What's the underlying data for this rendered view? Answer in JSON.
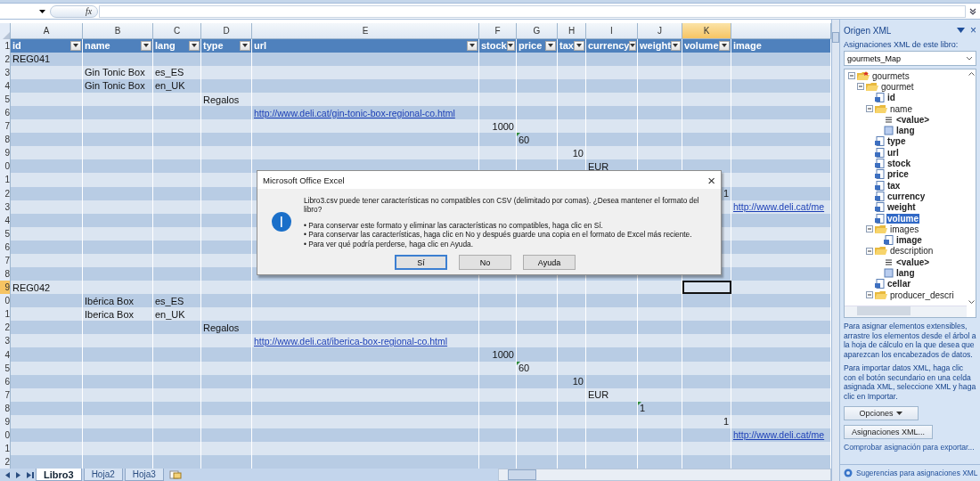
{
  "formula_bar": {
    "function_label": "fx"
  },
  "columns": [
    {
      "letter": "A",
      "header": "id",
      "filter": true,
      "selected": false
    },
    {
      "letter": "B",
      "header": "name",
      "filter": true,
      "selected": false
    },
    {
      "letter": "C",
      "header": "lang",
      "filter": true,
      "selected": false
    },
    {
      "letter": "D",
      "header": "type",
      "filter": true,
      "selected": false
    },
    {
      "letter": "E",
      "header": "url",
      "filter": true,
      "selected": false
    },
    {
      "letter": "F",
      "header": "stock",
      "filter": true,
      "selected": false
    },
    {
      "letter": "G",
      "header": "price",
      "filter": true,
      "selected": false
    },
    {
      "letter": "H",
      "header": "tax",
      "filter": true,
      "selected": false
    },
    {
      "letter": "I",
      "header": "currency",
      "filter": true,
      "selected": false
    },
    {
      "letter": "J",
      "header": "weight",
      "filter": true,
      "selected": false
    },
    {
      "letter": "K",
      "header": "volume",
      "filter": true,
      "selected": true
    },
    {
      "header": "image",
      "filter": false,
      "selected": false
    }
  ],
  "header_row_number": "1",
  "rows": [
    {
      "number": "2",
      "selected": false,
      "cells": [
        {
          "text": "REG041",
          "kind": "text",
          "active": false
        }
      ]
    },
    {
      "number": "3",
      "selected": false,
      "cells": [
        null,
        {
          "text": "Gin Tonic Box",
          "kind": "text",
          "active": false
        },
        {
          "text": "es_ES",
          "kind": "text",
          "active": false
        }
      ]
    },
    {
      "number": "4",
      "selected": false,
      "cells": [
        null,
        {
          "text": "Gin Tonic Box",
          "kind": "text",
          "active": false
        },
        {
          "text": "en_UK",
          "kind": "text",
          "active": false
        }
      ]
    },
    {
      "number": "5",
      "selected": false,
      "cells": [
        null,
        null,
        null,
        {
          "text": "Regalos",
          "kind": "text",
          "active": false
        }
      ]
    },
    {
      "number": "6",
      "selected": false,
      "cells": [
        null,
        null,
        null,
        null,
        {
          "text": "http://www.deli.cat/gin-tonic-box-regional-co.html",
          "kind": "link",
          "active": false
        }
      ]
    },
    {
      "number": "7",
      "selected": false,
      "cells": [
        null,
        null,
        null,
        null,
        null,
        {
          "text": "1000",
          "kind": "number",
          "active": false
        }
      ]
    },
    {
      "number": "8",
      "selected": false,
      "cells": [
        null,
        null,
        null,
        null,
        null,
        null,
        {
          "text": "60",
          "kind": "number_as_text",
          "active": false
        }
      ]
    },
    {
      "number": "9",
      "selected": false,
      "cells": [
        null,
        null,
        null,
        null,
        null,
        null,
        null,
        {
          "text": "10",
          "kind": "number",
          "active": false
        }
      ]
    },
    {
      "number": "0",
      "selected": false,
      "cells": [
        null,
        null,
        null,
        null,
        null,
        null,
        null,
        null,
        {
          "text": "EUR",
          "kind": "text",
          "active": false
        }
      ]
    },
    {
      "number": "1",
      "selected": false
    },
    {
      "number": "2",
      "selected": false,
      "cells": [
        null,
        null,
        null,
        null,
        null,
        null,
        null,
        null,
        null,
        null,
        {
          "text": "1",
          "kind": "number",
          "active": false
        }
      ]
    },
    {
      "number": "3",
      "selected": false,
      "cells": [
        null,
        null,
        null,
        null,
        null,
        null,
        null,
        null,
        null,
        null,
        null,
        {
          "text": "http://www.deli.cat/me",
          "kind": "link",
          "active": false
        }
      ]
    },
    {
      "number": "4",
      "selected": false
    },
    {
      "number": "5",
      "selected": false
    },
    {
      "number": "6",
      "selected": false
    },
    {
      "number": "7",
      "selected": false
    },
    {
      "number": "8",
      "selected": false
    },
    {
      "number": "9",
      "selected": true,
      "cells": [
        {
          "text": "REG042",
          "kind": "text",
          "active": false
        },
        null,
        null,
        null,
        null,
        null,
        null,
        null,
        null,
        null,
        {
          "kind": "blank",
          "active": true
        }
      ]
    },
    {
      "number": "0",
      "selected": false,
      "cells": [
        null,
        {
          "text": "Ibérica Box",
          "kind": "text",
          "active": false
        },
        {
          "text": "es_ES",
          "kind": "text",
          "active": false
        }
      ]
    },
    {
      "number": "1",
      "selected": false,
      "cells": [
        null,
        {
          "text": "Iberica Box",
          "kind": "text",
          "active": false
        },
        {
          "text": "en_UK",
          "kind": "text",
          "active": false
        }
      ]
    },
    {
      "number": "2",
      "selected": false,
      "cells": [
        null,
        null,
        null,
        {
          "text": "Regalos",
          "kind": "text",
          "active": false
        }
      ]
    },
    {
      "number": "3",
      "selected": false,
      "cells": [
        null,
        null,
        null,
        null,
        {
          "text": "http://www.deli.cat/iberica-box-regional-co.html",
          "kind": "link",
          "active": false
        }
      ]
    },
    {
      "number": "4",
      "selected": false,
      "cells": [
        null,
        null,
        null,
        null,
        null,
        {
          "text": "1000",
          "kind": "number",
          "active": false
        }
      ]
    },
    {
      "number": "5",
      "selected": false,
      "cells": [
        null,
        null,
        null,
        null,
        null,
        null,
        {
          "text": "60",
          "kind": "number_as_text",
          "active": false
        }
      ]
    },
    {
      "number": "6",
      "selected": false,
      "cells": [
        null,
        null,
        null,
        null,
        null,
        null,
        null,
        {
          "text": "10",
          "kind": "number",
          "active": false
        }
      ]
    },
    {
      "number": "7",
      "selected": false,
      "cells": [
        null,
        null,
        null,
        null,
        null,
        null,
        null,
        null,
        {
          "text": "EUR",
          "kind": "text",
          "active": false
        }
      ]
    },
    {
      "number": "8",
      "selected": false,
      "cells": [
        null,
        null,
        null,
        null,
        null,
        null,
        null,
        null,
        null,
        {
          "text": "1",
          "kind": "number_as_text",
          "active": false
        }
      ]
    },
    {
      "number": "9",
      "selected": false,
      "cells": [
        null,
        null,
        null,
        null,
        null,
        null,
        null,
        null,
        null,
        null,
        {
          "text": "1",
          "kind": "number",
          "active": false
        }
      ]
    },
    {
      "number": "0",
      "selected": false,
      "cells": [
        null,
        null,
        null,
        null,
        null,
        null,
        null,
        null,
        null,
        null,
        null,
        {
          "text": "http://www.deli.cat/me",
          "kind": "link",
          "active": false
        }
      ]
    },
    {
      "number": "1",
      "selected": false
    },
    {
      "number": "2",
      "selected": false
    }
  ],
  "sheet_tabs": [
    {
      "label": "Libro3",
      "selected": true
    },
    {
      "label": "Hoja2",
      "selected": false
    },
    {
      "label": "Hoja3",
      "selected": false
    }
  ],
  "dialog": {
    "title": "Microsoft Office Excel",
    "close_label": "×",
    "message": "Libro3.csv puede tener características no compatibles con CSV (delimitado por comas). ¿Desea mantener el formato del libro?",
    "bullets": [
      "• Para conservar este formato y eliminar las características no compatibles, haga clic en Sí.",
      "• Para conservar las características, haga clic en No y después guarde una copia en el formato de Excel más reciente.",
      "• Para ver qué podría perderse, haga clic en Ayuda."
    ],
    "buttons": [
      {
        "label": "Sí",
        "default": true
      },
      {
        "label": "No",
        "default": false
      },
      {
        "label": "Ayuda",
        "default": false
      }
    ]
  },
  "panel": {
    "title": "Origen XML",
    "close_label": "×",
    "maps_label": "Asignaciones XML de este libro:",
    "map": "gourmets_Map",
    "tree": [
      {
        "label": "gourmets",
        "kind": "root",
        "selected": false,
        "expanded": true,
        "children": [
          {
            "label": "gourmet",
            "kind": "folder",
            "selected": false,
            "expanded": true,
            "children": [
              {
                "label": "id",
                "kind": "element",
                "selected": false
              },
              {
                "label": "name",
                "kind": "folder",
                "selected": false,
                "expanded": true,
                "children": [
                  {
                    "label": "<value>",
                    "kind": "value",
                    "selected": false
                  },
                  {
                    "label": "lang",
                    "kind": "attribute",
                    "selected": false
                  }
                ]
              },
              {
                "label": "type",
                "kind": "element",
                "selected": false
              },
              {
                "label": "url",
                "kind": "element",
                "selected": false
              },
              {
                "label": "stock",
                "kind": "element",
                "selected": false
              },
              {
                "label": "price",
                "kind": "element",
                "selected": false
              },
              {
                "label": "tax",
                "kind": "element",
                "selected": false
              },
              {
                "label": "currency",
                "kind": "element",
                "selected": false
              },
              {
                "label": "weight",
                "kind": "element",
                "selected": false
              },
              {
                "label": "volume",
                "kind": "element",
                "selected": true
              },
              {
                "label": "images",
                "kind": "folder",
                "selected": false,
                "expanded": true,
                "children": [
                  {
                    "label": "image",
                    "kind": "element",
                    "selected": false
                  }
                ]
              },
              {
                "label": "description",
                "kind": "folder",
                "selected": false,
                "expanded": true,
                "children": [
                  {
                    "label": "<value>",
                    "kind": "value",
                    "selected": false
                  },
                  {
                    "label": "lang",
                    "kind": "attribute",
                    "selected": false
                  }
                ]
              },
              {
                "label": "cellar",
                "kind": "element",
                "selected": false
              },
              {
                "label": "producer_descri",
                "kind": "folder",
                "selected": false,
                "expanded": true
              }
            ]
          }
        ]
      }
    ],
    "hint_1": "Para asignar elementos extensibles, arrastre los elementos desde el árbol a la hoja de cálculo en la que desea que aparezcan los encabezados de datos.",
    "hint_2": "Para importar datos XML, haga clic con el botón secundario en una celda asignada XML, seleccione XML y haga clic en Importar.",
    "options_button": "Opciones",
    "maps_button": "Asignaciones XML...",
    "verify_link": "Comprobar asignación para exportar...",
    "help_link": "Sugerencias para asignaciones XML"
  }
}
